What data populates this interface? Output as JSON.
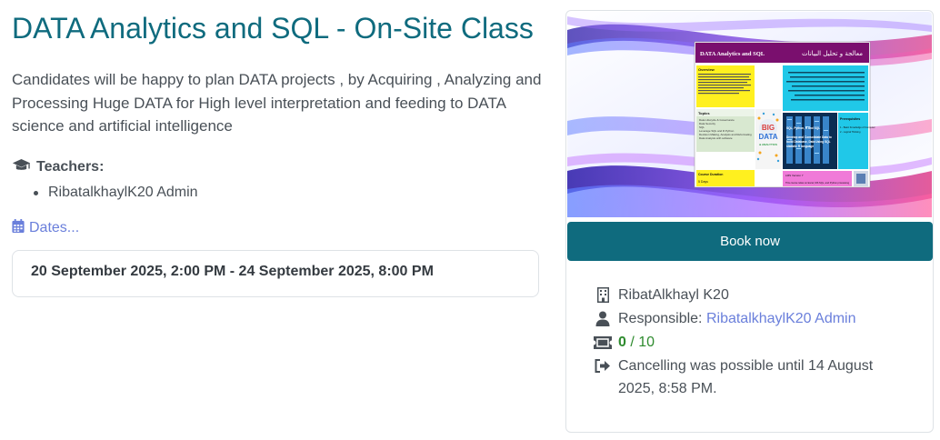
{
  "course": {
    "title": "DATA Analytics and SQL - On-Site Class",
    "description": "Candidates will be happy to plan DATA projects , by Acquiring , Analyzing and Processing Huge DATA for High level interpretation and feeding to DATA science and artificial intelligence",
    "teachers_label": "Teachers:",
    "teachers": [
      "RibatalkhaylK20 Admin"
    ],
    "dates_link": "Dates...",
    "date_range": "20 September 2025, 2:00 PM - 24 September 2025, 8:00 PM"
  },
  "sidebar": {
    "banner": {
      "title_en": "DATA Analytics and SQL",
      "title_ar": "معالجة و تحليل البيانات",
      "overview_label": "Overview",
      "topics_label": "Topics",
      "prerequisites_label": "Prerequisites",
      "duration_label": "Course Duration",
      "duration_value": "5 Days",
      "bigdata_line1": "BIG",
      "bigdata_line2": "DATA",
      "bigdata_line3": "& ANALYTICS",
      "topics": [
        "Data Lifecycle & Governance",
        "Data Security",
        "SQL",
        "Leverage SQL and R Python",
        "Decision Making, Analysis and Reformating",
        "Data Analysis with software"
      ],
      "prerequisites": [
        "1 - Basic Knowledge of Computer",
        "2 - Logical Thinking"
      ],
      "sql_line1": "SQL, Python, R and SQL",
      "sql_line2": "Develop and Consolidate Data to",
      "sql_line3": "build Database, Data Using SQL",
      "sql_line4": "statistic R language",
      "footer_label": "LMS Version 7",
      "footer_text": "This course relies on Excel, MS SQL, and Python processing"
    },
    "book_label": "Book now",
    "location": "RibatAlkhayl K20",
    "responsible_label": "Responsible:",
    "responsible_name": "RibatalkhaylK20 Admin",
    "seats_booked": "0",
    "seats_sep": "/",
    "seats_total": "10",
    "cancel_text": "Cancelling was possible until 14 August 2025, 8:58 PM."
  },
  "colors": {
    "primary": "#0f6b7e",
    "link": "#6a7fdb",
    "success": "#2e8b2e",
    "text": "#495057"
  }
}
